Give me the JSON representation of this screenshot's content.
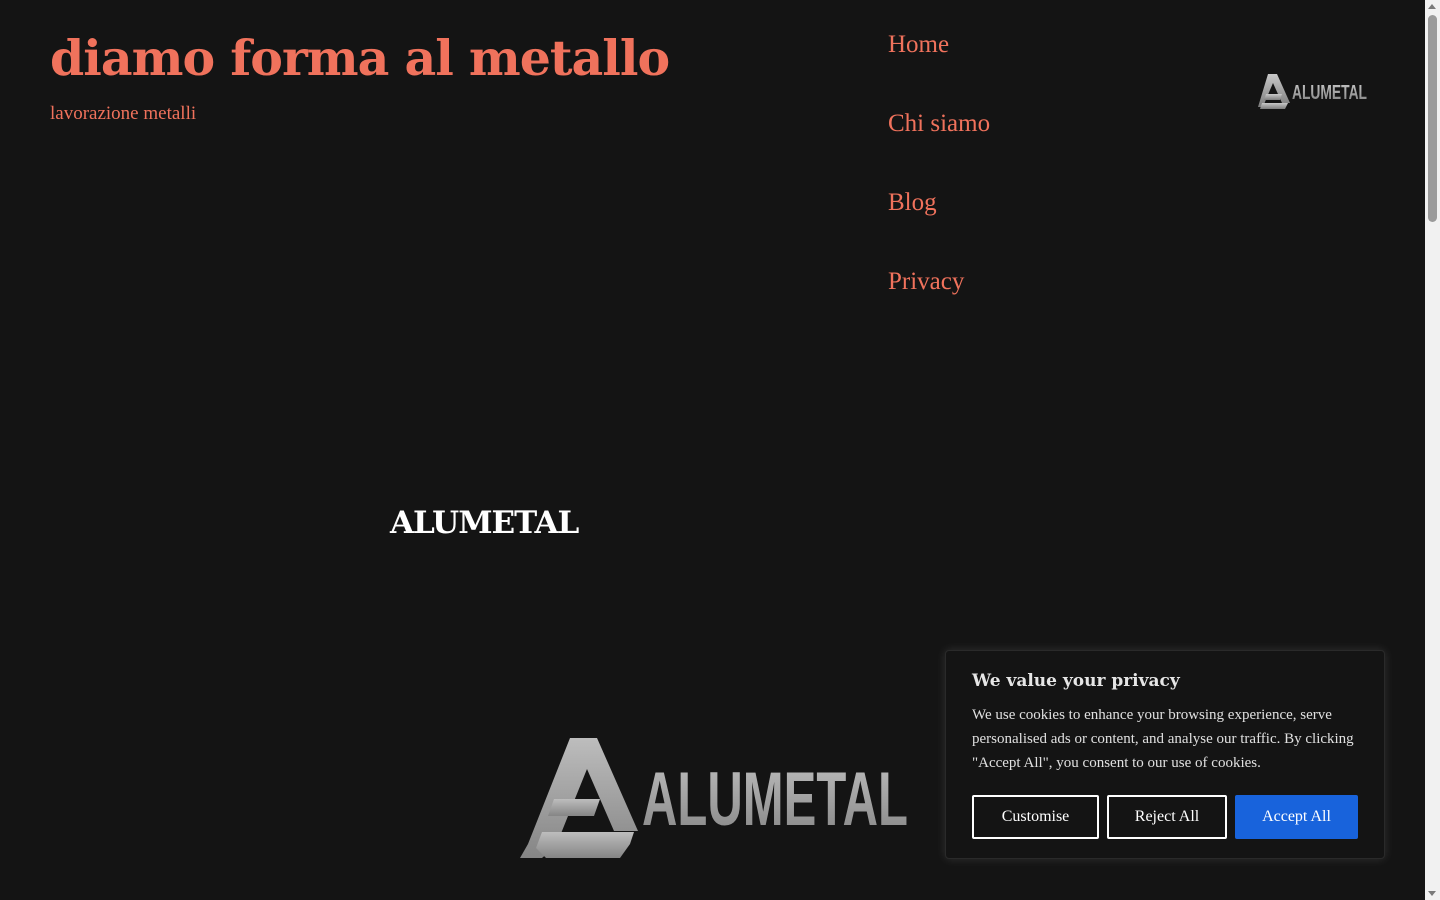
{
  "site": {
    "title": "diamo forma al metallo",
    "tagline": "lavorazione metalli"
  },
  "nav": {
    "items": [
      {
        "label": "Home"
      },
      {
        "label": "Chi siamo"
      },
      {
        "label": "Blog"
      },
      {
        "label": "Privacy"
      }
    ]
  },
  "header_logo": {
    "text": "ALUMETAL"
  },
  "main": {
    "heading": "ALUMETAL",
    "logo_text": "ALUMETAL"
  },
  "cookie_banner": {
    "title": "We value your privacy",
    "text": "We use cookies to enhance your browsing experience, serve personalised ads or content, and analyse our traffic. By clicking \"Accept All\", you consent to our use of cookies.",
    "customise_label": "Customise",
    "reject_label": "Reject All",
    "accept_label": "Accept All"
  },
  "colors": {
    "background": "#141414",
    "accent": "#f0725c",
    "button_primary": "#1863dc"
  }
}
